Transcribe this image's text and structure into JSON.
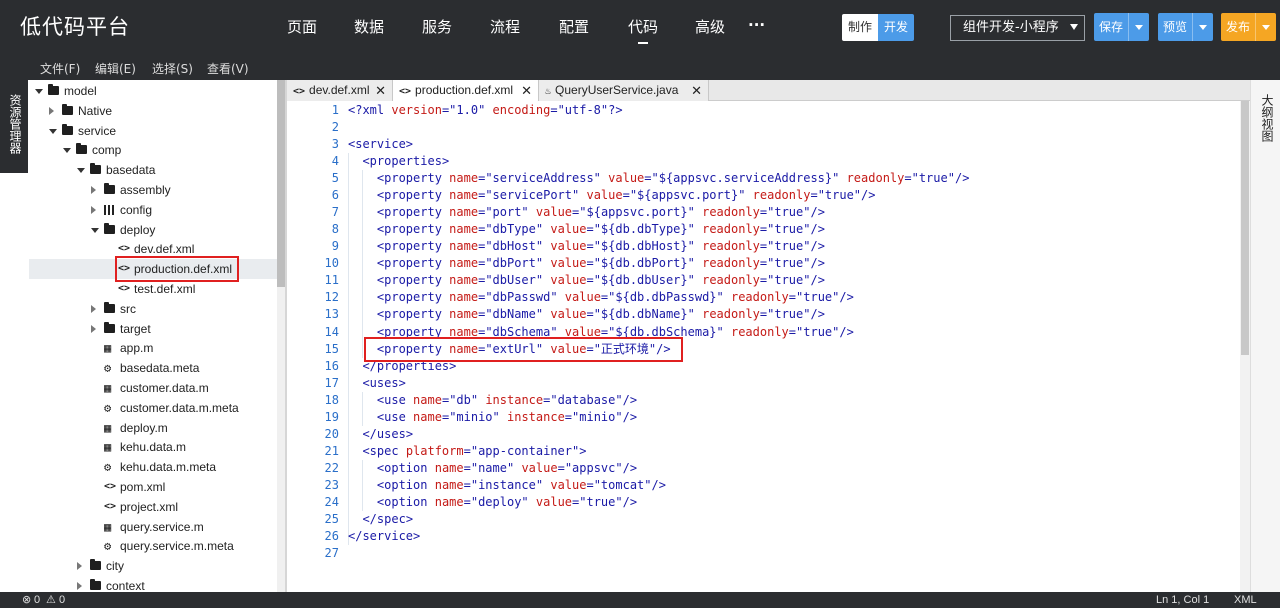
{
  "app": {
    "title": "低代码平台"
  },
  "nav": {
    "items": [
      "页面",
      "数据",
      "服务",
      "流程",
      "配置",
      "代码",
      "高级",
      "..."
    ],
    "active": "代码"
  },
  "mode_toggle": {
    "make": "制作",
    "dev": "开发"
  },
  "project_select": {
    "value": "组件开发-小程序"
  },
  "actions": {
    "save": {
      "label": "保存",
      "color": "#4c9be8"
    },
    "preview": {
      "label": "预览",
      "color": "#4c9be8"
    },
    "publish": {
      "label": "发布",
      "color": "#f5a623"
    }
  },
  "menubar": {
    "items": [
      "文件(F)",
      "编辑(E)",
      "选择(S)",
      "查看(V)"
    ]
  },
  "left_rail": {
    "label": "资源管理器"
  },
  "right_rail": {
    "label": "大纲视图"
  },
  "tree": [
    {
      "label": "model",
      "type": "folder",
      "expanded": true
    },
    {
      "label": "Native",
      "type": "folder",
      "expanded": false
    },
    {
      "label": "service",
      "type": "folder",
      "expanded": true
    },
    {
      "label": "comp",
      "type": "folder",
      "expanded": true
    },
    {
      "label": "basedata",
      "type": "folder",
      "expanded": true
    },
    {
      "label": "assembly",
      "type": "folder",
      "expanded": false
    },
    {
      "label": "config",
      "type": "config",
      "expanded": false
    },
    {
      "label": "deploy",
      "type": "folder",
      "expanded": true
    },
    {
      "label": "dev.def.xml",
      "type": "xml"
    },
    {
      "label": "production.def.xml",
      "type": "xml",
      "selected": true
    },
    {
      "label": "test.def.xml",
      "type": "xml"
    },
    {
      "label": "src",
      "type": "folder",
      "expanded": false
    },
    {
      "label": "target",
      "type": "folder",
      "expanded": false
    },
    {
      "label": "app.m",
      "type": "model"
    },
    {
      "label": "basedata.meta",
      "type": "meta"
    },
    {
      "label": "customer.data.m",
      "type": "model"
    },
    {
      "label": "customer.data.m.meta",
      "type": "meta"
    },
    {
      "label": "deploy.m",
      "type": "model"
    },
    {
      "label": "kehu.data.m",
      "type": "model"
    },
    {
      "label": "kehu.data.m.meta",
      "type": "meta"
    },
    {
      "label": "pom.xml",
      "type": "xml"
    },
    {
      "label": "project.xml",
      "type": "xml"
    },
    {
      "label": "query.service.m",
      "type": "model"
    },
    {
      "label": "query.service.m.meta",
      "type": "meta"
    },
    {
      "label": "city",
      "type": "folder",
      "expanded": false
    },
    {
      "label": "context",
      "type": "folder",
      "expanded": false
    }
  ],
  "tabs": [
    {
      "label": "dev.def.xml",
      "icon": "xml"
    },
    {
      "label": "production.def.xml",
      "icon": "xml",
      "active": true
    },
    {
      "label": "QueryUserService.java",
      "icon": "java"
    }
  ],
  "code_lines": [
    "<?xml version=\"1.0\" encoding=\"utf-8\"?>",
    "",
    "<service>",
    "  <properties>",
    "    <property name=\"serviceAddress\" value=\"${appsvc.serviceAddress}\" readonly=\"true\"/>",
    "    <property name=\"servicePort\" value=\"${appsvc.port}\" readonly=\"true\"/>",
    "    <property name=\"port\" value=\"${appsvc.port}\" readonly=\"true\"/>",
    "    <property name=\"dbType\" value=\"${db.dbType}\" readonly=\"true\"/>",
    "    <property name=\"dbHost\" value=\"${db.dbHost}\" readonly=\"true\"/>",
    "    <property name=\"dbPort\" value=\"${db.dbPort}\" readonly=\"true\"/>",
    "    <property name=\"dbUser\" value=\"${db.dbUser}\" readonly=\"true\"/>",
    "    <property name=\"dbPasswd\" value=\"${db.dbPasswd}\" readonly=\"true\"/>",
    "    <property name=\"dbName\" value=\"${db.dbName}\" readonly=\"true\"/>",
    "    <property name=\"dbSchema\" value=\"${db.dbSchema}\" readonly=\"true\"/>",
    "    <property name=\"extUrl\" value=\"正式环境\"/>",
    "  </properties>",
    "  <uses>",
    "    <use name=\"db\" instance=\"database\"/>",
    "    <use name=\"minio\" instance=\"minio\"/>",
    "  </uses>",
    "  <spec platform=\"app-container\">",
    "    <option name=\"name\" value=\"appsvc\"/>",
    "    <option name=\"instance\" value=\"tomcat\"/>",
    "    <option name=\"deploy\" value=\"true\"/>",
    "  </spec>",
    "</service>",
    ""
  ],
  "status": {
    "errors": "0",
    "warnings": "0",
    "cursor": "Ln 1, Col 1",
    "language": "XML"
  }
}
